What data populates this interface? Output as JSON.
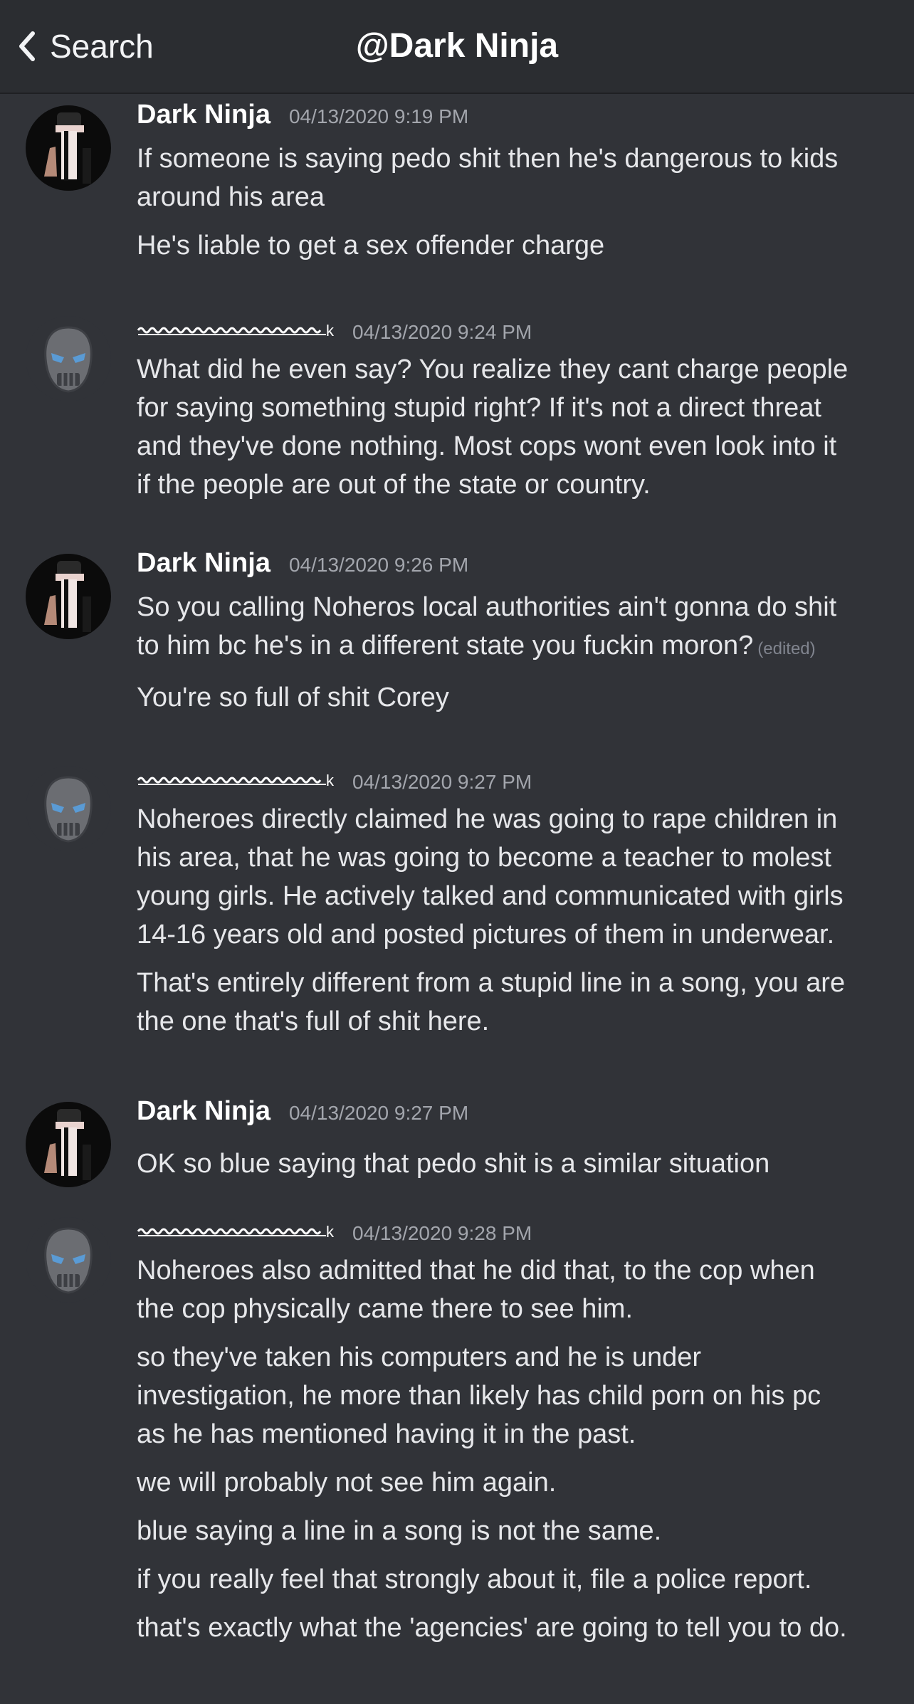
{
  "header": {
    "back_label": "Search",
    "title": "@Dark Ninja"
  },
  "groups": [
    {
      "author": "Dark Ninja",
      "timestamp": "04/13/2020 9:19 PM",
      "messages": [
        [
          "If someone is saying pedo shit then he's dangerous to kids",
          "around his area"
        ],
        [
          "He's liable to get a sex offender charge"
        ]
      ]
    },
    {
      "author_suffix": "k",
      "timestamp": "04/13/2020 9:24 PM",
      "messages": [
        [
          "What did he even say? You realize they cant charge people",
          "for saying something stupid right? If it's not a direct threat",
          "and they've done nothing. Most cops wont even look into it",
          "if the people are out of the state or country."
        ]
      ]
    },
    {
      "author": "Dark Ninja",
      "timestamp": "04/13/2020 9:26 PM",
      "edited_label": "(edited)",
      "messages": [
        [
          "So you calling Noheros local authorities ain't gonna do shit",
          "to him bc he's in a different state you fuckin moron?"
        ],
        [
          "You're so full of shit Corey"
        ]
      ]
    },
    {
      "author_suffix": "k",
      "timestamp": "04/13/2020 9:27 PM",
      "messages": [
        [
          "Noheroes directly claimed he was going to rape children in",
          "his area, that he was going to become a teacher to molest",
          "young girls. He actively talked and communicated with girls",
          "14-16 years old and posted pictures of them in underwear."
        ],
        [
          "That's entirely different from a stupid line in a song, you are",
          "the one that's full of shit here."
        ]
      ]
    },
    {
      "author": "Dark Ninja",
      "timestamp": "04/13/2020 9:27 PM",
      "messages": [
        [
          "OK so blue saying that pedo shit is a similar situation"
        ]
      ]
    },
    {
      "author_suffix": "k",
      "timestamp": "04/13/2020 9:28 PM",
      "messages": [
        [
          "Noheroes also admitted that he did that, to the cop when",
          "the cop physically came there to see him."
        ],
        [
          "so they've taken his computers and he is under",
          "investigation, he more than likely has child porn on his pc",
          "as he has mentioned having it in the past."
        ],
        [
          "we will probably not see him again."
        ],
        [
          "blue saying a line in a song is not the same."
        ],
        [
          "if you really feel that strongly about it, file a police report."
        ],
        [
          "that's exactly what the 'agencies' are going to tell you to do."
        ]
      ]
    }
  ],
  "colors": {
    "background": "#313338",
    "header_background": "#2b2d31",
    "timestamp": "#a3a6ad",
    "text": "#e6e7ea"
  },
  "icons": {
    "back": "chevron-left-icon",
    "ninja_avatar": "ninja-avatar",
    "skull_avatar": "skull-mask-avatar"
  }
}
